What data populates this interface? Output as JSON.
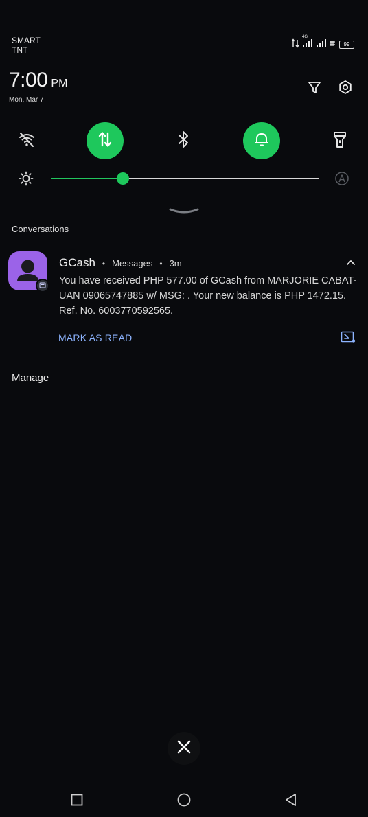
{
  "status_bar": {
    "carrier_line1": "SMART",
    "carrier_line2": "TNT",
    "network_label": "4G",
    "battery": "99",
    "icons": [
      "data-arrows-icon",
      "signal-icon",
      "signal-icon",
      "wifi-calling-icon",
      "battery-icon"
    ]
  },
  "header": {
    "time": "7:00",
    "ampm": "PM",
    "date": "Mon, Mar 7",
    "actions": [
      "filter-icon",
      "settings-icon"
    ]
  },
  "quick_settings": {
    "tiles": [
      {
        "name": "wifi",
        "icon": "wifi-off-icon",
        "active": false
      },
      {
        "name": "mobile-data",
        "icon": "data-arrows-icon",
        "active": true
      },
      {
        "name": "bluetooth",
        "icon": "bluetooth-icon",
        "active": false
      },
      {
        "name": "sound",
        "icon": "bell-icon",
        "active": true
      },
      {
        "name": "flashlight",
        "icon": "flashlight-icon",
        "active": false
      }
    ],
    "brightness_level": 0.27,
    "accent": "#1ec85c"
  },
  "conversations": {
    "section_title": "Conversations",
    "notification": {
      "app_name": "GCash",
      "source": "Messages",
      "age": "3m",
      "body": "You have received PHP 577.00 of GCash from MARJORIE CABAT-UAN 09065747885 w/ MSG: . Your new balance is PHP 1472.15. Ref. No. 6003770592565.",
      "action_label": "MARK AS READ",
      "icon_color": "#9b63e8"
    }
  },
  "manage_label": "Manage",
  "colors": {
    "background": "#090a0d",
    "link": "#8db4ff"
  }
}
